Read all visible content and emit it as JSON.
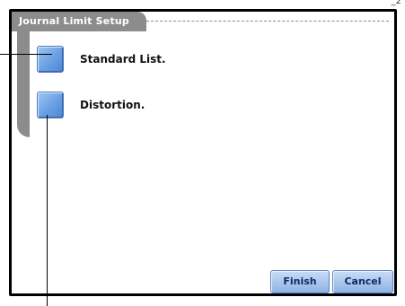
{
  "corner_text": "_2",
  "dialog": {
    "title": "Journal Limit Setup"
  },
  "options": [
    {
      "label": "Standard List."
    },
    {
      "label": "Distortion."
    }
  ],
  "buttons": {
    "finish": "Finish",
    "cancel": "Cancel"
  },
  "colors": {
    "accent": "#8c8c8c",
    "button_blue": "#6a9fe3"
  }
}
